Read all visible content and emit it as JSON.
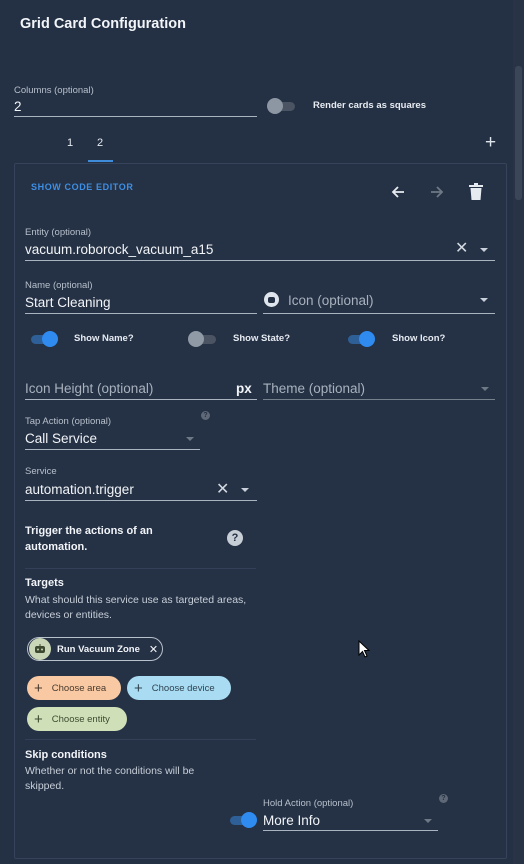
{
  "dialog": {
    "title": "Grid Card Configuration"
  },
  "columns": {
    "label": "Columns (optional)",
    "value": "2"
  },
  "render_square": {
    "label": "Render cards as squares",
    "on": false
  },
  "tabs": [
    {
      "label": "1"
    },
    {
      "label": "2"
    }
  ],
  "active_tab": "2",
  "add_tab": "+",
  "card": {
    "show_code_editor": "SHOW CODE EDITOR",
    "entity": {
      "label": "Entity (optional)",
      "value": "vacuum.roborock_vacuum_a15"
    },
    "name": {
      "label": "Name (optional)",
      "value": "Start Cleaning"
    },
    "icon": {
      "placeholder": "Icon (optional)"
    },
    "toggles": {
      "show_name": {
        "label": "Show Name?",
        "on": true
      },
      "show_state": {
        "label": "Show State?",
        "on": false
      },
      "show_icon": {
        "label": "Show Icon?",
        "on": true
      }
    },
    "icon_height": {
      "placeholder": "Icon Height (optional)",
      "suffix": "px"
    },
    "theme": {
      "placeholder": "Theme (optional)"
    },
    "tap_action": {
      "label": "Tap Action (optional)",
      "value": "Call Service"
    },
    "service": {
      "label": "Service",
      "value": "automation.trigger"
    },
    "trigger_desc": "Trigger the actions of an automation.",
    "targets": {
      "title": "Targets",
      "desc": "What should this service use as targeted areas, devices or entities.",
      "chip": "Run Vacuum Zone",
      "choose_area": "Choose area",
      "choose_device": "Choose device",
      "choose_entity": "Choose entity"
    },
    "skip": {
      "title": "Skip conditions",
      "desc": "Whether or not the conditions will be skipped.",
      "on": true
    },
    "hold_action": {
      "label": "Hold Action (optional)",
      "value": "More Info"
    }
  },
  "colors": {
    "accent": "#2f8bf0",
    "background": "#243043",
    "area": "#f8c9a3",
    "device": "#a9dcf2",
    "entity": "#cfe0b8"
  }
}
